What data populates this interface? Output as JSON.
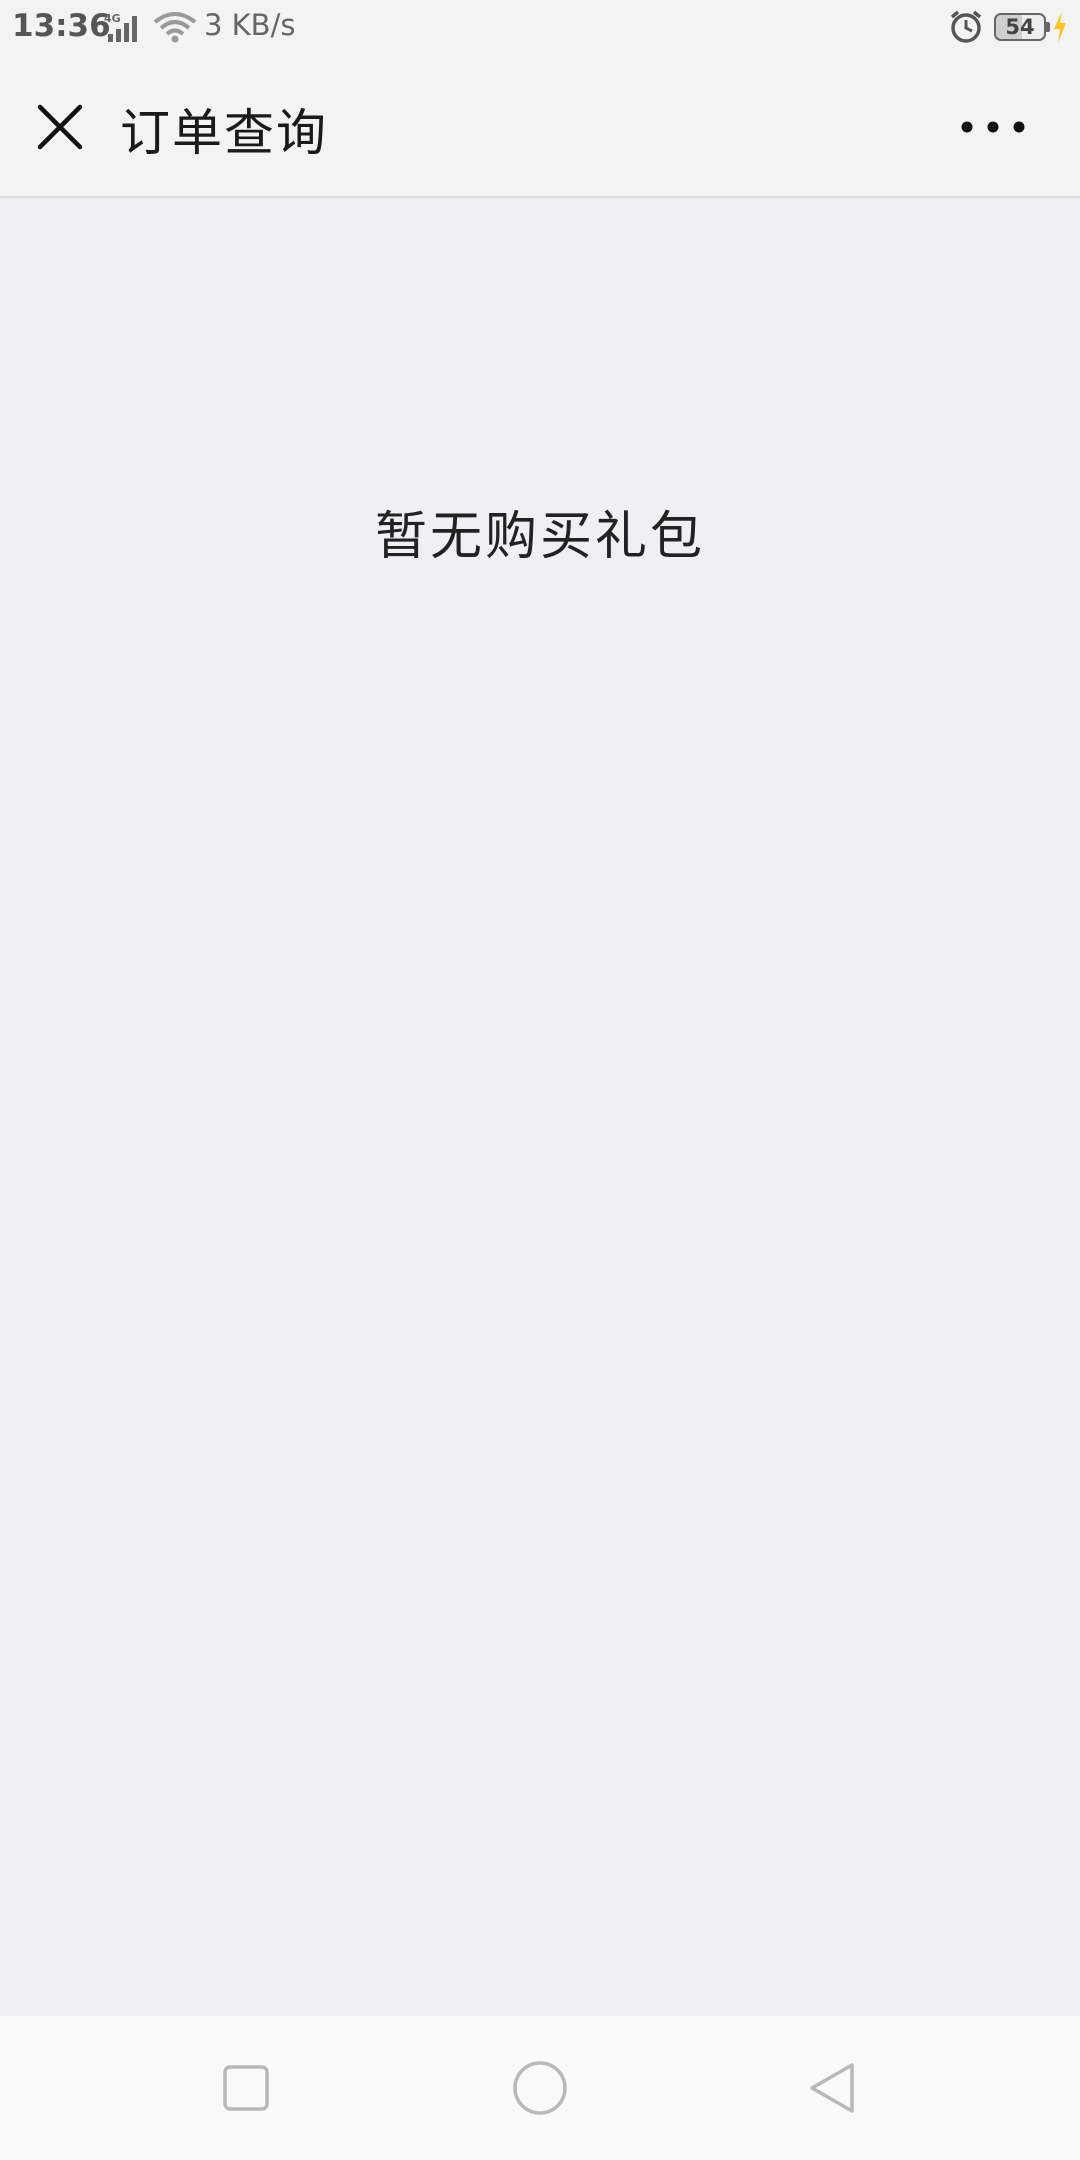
{
  "status_bar": {
    "time": "13:36",
    "network_type": "4G",
    "speed": "3 KB/s",
    "battery_level": "54",
    "icons": [
      "signal-icon",
      "wifi-icon",
      "alarm-icon",
      "battery-icon",
      "charging-icon"
    ]
  },
  "header": {
    "title": "订单查询",
    "close_icon": "close-icon",
    "more_icon": "more-icon"
  },
  "main": {
    "empty_message": "暂无购买礼包"
  },
  "system_nav": {
    "icons": [
      "recent-apps-icon",
      "home-icon",
      "back-icon"
    ]
  },
  "colors": {
    "status_bar_bg": "#f3f3f3",
    "nav_bg": "#f3f3f3",
    "content_bg": "#f0eff4",
    "system_nav_bg": "#fafafa",
    "charging_accent": "#f5c623"
  }
}
